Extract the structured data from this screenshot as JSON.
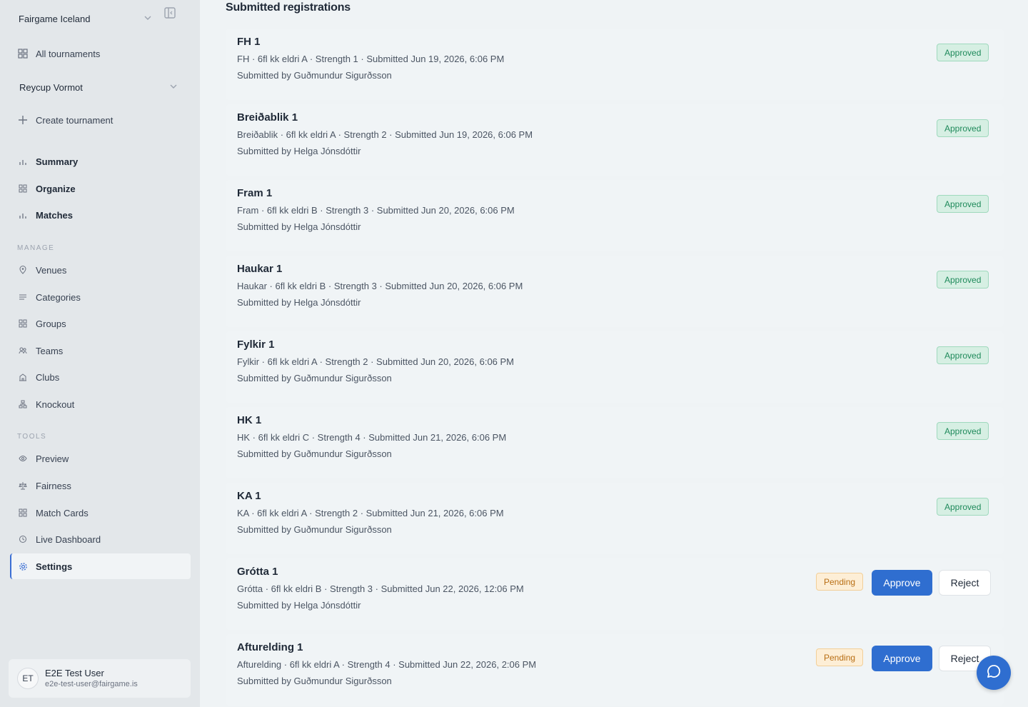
{
  "sidebar": {
    "org_name": "Fairgame Iceland",
    "all_tournaments": "All tournaments",
    "tournament_name": "Reycup Vormot",
    "create_tournament": "Create tournament",
    "primary_nav": [
      {
        "label": "Summary",
        "icon": "bar-chart-icon"
      },
      {
        "label": "Organize",
        "icon": "grid-icon"
      },
      {
        "label": "Matches",
        "icon": "bar-chart-icon"
      }
    ],
    "manage_label": "MANAGE",
    "manage_items": [
      {
        "label": "Venues",
        "icon": "map-pin-icon"
      },
      {
        "label": "Categories",
        "icon": "list-icon"
      },
      {
        "label": "Groups",
        "icon": "grid-icon"
      },
      {
        "label": "Teams",
        "icon": "users-icon"
      },
      {
        "label": "Clubs",
        "icon": "building-icon"
      },
      {
        "label": "Knockout",
        "icon": "bracket-icon"
      }
    ],
    "tools_label": "TOOLS",
    "tools_items": [
      {
        "label": "Preview",
        "icon": "eye-icon"
      },
      {
        "label": "Fairness",
        "icon": "scale-icon"
      },
      {
        "label": "Match Cards",
        "icon": "cards-icon"
      },
      {
        "label": "Live Dashboard",
        "icon": "clock-icon"
      },
      {
        "label": "Settings",
        "icon": "gear-icon",
        "active": true
      }
    ],
    "user": {
      "initials": "ET",
      "name": "E2E Test User",
      "email": "e2e-test-user@fairgame.is"
    }
  },
  "main": {
    "title": "Submitted registrations",
    "approve_label": "Approve",
    "reject_label": "Reject",
    "registrations": [
      {
        "team": "FH 1",
        "meta": "FH · 6fl kk eldri A · Strength 1 · Submitted Jun 19, 2026, 6:06 PM",
        "submitted_by": "Submitted by Guðmundur Sigurðsson",
        "status": "Approved"
      },
      {
        "team": "Breiðablik 1",
        "meta": "Breiðablik · 6fl kk eldri A · Strength 2 · Submitted Jun 19, 2026, 6:06 PM",
        "submitted_by": "Submitted by Helga Jónsdóttir",
        "status": "Approved"
      },
      {
        "team": "Fram 1",
        "meta": "Fram · 6fl kk eldri B · Strength 3 · Submitted Jun 20, 2026, 6:06 PM",
        "submitted_by": "Submitted by Helga Jónsdóttir",
        "status": "Approved"
      },
      {
        "team": "Haukar 1",
        "meta": "Haukar · 6fl kk eldri B · Strength 3 · Submitted Jun 20, 2026, 6:06 PM",
        "submitted_by": "Submitted by Helga Jónsdóttir",
        "status": "Approved"
      },
      {
        "team": "Fylkir 1",
        "meta": "Fylkir · 6fl kk eldri A · Strength 2 · Submitted Jun 20, 2026, 6:06 PM",
        "submitted_by": "Submitted by Guðmundur Sigurðsson",
        "status": "Approved"
      },
      {
        "team": "HK 1",
        "meta": "HK · 6fl kk eldri C · Strength 4 · Submitted Jun 21, 2026, 6:06 PM",
        "submitted_by": "Submitted by Guðmundur Sigurðsson",
        "status": "Approved"
      },
      {
        "team": "KA 1",
        "meta": "KA · 6fl kk eldri A · Strength 2 · Submitted Jun 21, 2026, 6:06 PM",
        "submitted_by": "Submitted by Guðmundur Sigurðsson",
        "status": "Approved"
      },
      {
        "team": "Grótta 1",
        "meta": "Grótta · 6fl kk eldri B · Strength 3 · Submitted Jun 22, 2026, 12:06 PM",
        "submitted_by": "Submitted by Helga Jónsdóttir",
        "status": "Pending"
      },
      {
        "team": "Afturelding 1",
        "meta": "Afturelding · 6fl kk eldri A · Strength 4 · Submitted Jun 22, 2026, 2:06 PM",
        "submitted_by": "Submitted by Guðmundur Sigurðsson",
        "status": "Pending"
      }
    ]
  },
  "chat": {
    "icon": "chat-bubble-icon"
  },
  "colors": {
    "accent": "#2f6ed0",
    "approved_bg": "#d6efe3",
    "approved_text": "#1f8a5b",
    "pending_bg": "#fdeed6",
    "pending_text": "#b86e14",
    "sidebar_bg": "#e3e7ea"
  }
}
